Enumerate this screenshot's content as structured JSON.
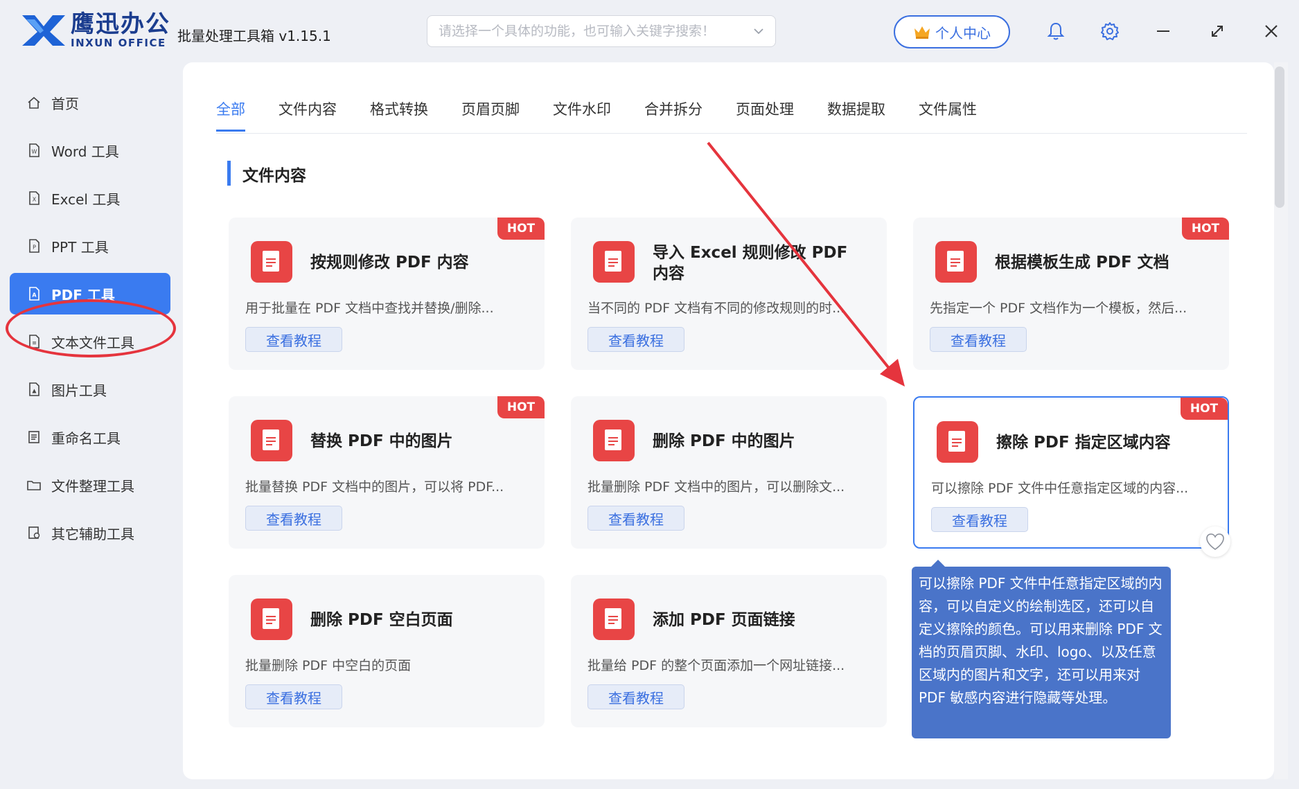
{
  "app": {
    "brand_cn": "鹰迅办公",
    "brand_en": "INXUN OFFICE",
    "title": "批量处理工具箱 v1.15.1"
  },
  "search": {
    "placeholder": "请选择一个具体的功能，也可输入关键字搜索！"
  },
  "header": {
    "user_center": "个人中心"
  },
  "sidebar": {
    "items": [
      {
        "label": "首页",
        "icon": "home-icon"
      },
      {
        "label": "Word 工具",
        "icon": "word-file-icon"
      },
      {
        "label": "Excel 工具",
        "icon": "excel-file-icon"
      },
      {
        "label": "PPT 工具",
        "icon": "ppt-file-icon"
      },
      {
        "label": "PDF 工具",
        "icon": "pdf-file-icon",
        "active": true
      },
      {
        "label": "文本文件工具",
        "icon": "text-file-icon"
      },
      {
        "label": "图片工具",
        "icon": "image-file-icon"
      },
      {
        "label": "重命名工具",
        "icon": "rename-icon"
      },
      {
        "label": "文件整理工具",
        "icon": "folder-icon"
      },
      {
        "label": "其它辅助工具",
        "icon": "tools-icon"
      }
    ]
  },
  "tabs": [
    {
      "label": "全部",
      "active": true
    },
    {
      "label": "文件内容"
    },
    {
      "label": "格式转换"
    },
    {
      "label": "页眉页脚"
    },
    {
      "label": "文件水印"
    },
    {
      "label": "合并拆分"
    },
    {
      "label": "页面处理"
    },
    {
      "label": "数据提取"
    },
    {
      "label": "文件属性"
    }
  ],
  "section": {
    "title": "文件内容"
  },
  "cards": [
    {
      "title": "按规则修改 PDF 内容",
      "desc": "用于批量在 PDF 文档中查找并替换/删除...",
      "button": "查看教程",
      "badge": "HOT"
    },
    {
      "title": "导入 Excel 规则修改 PDF 内容",
      "desc": "当不同的 PDF 文档有不同的修改规则的时...",
      "button": "查看教程"
    },
    {
      "title": "根据模板生成 PDF 文档",
      "desc": "先指定一个 PDF 文档作为一个模板，然后...",
      "button": "查看教程",
      "badge": "HOT"
    },
    {
      "title": "替换 PDF 中的图片",
      "desc": "批量替换 PDF 文档中的图片，可以将 PDF...",
      "button": "查看教程",
      "badge": "HOT"
    },
    {
      "title": "删除 PDF 中的图片",
      "desc": "批量删除 PDF 文档中的图片，可以删除文...",
      "button": "查看教程"
    },
    {
      "title": "擦除 PDF 指定区域内容",
      "desc": "可以擦除 PDF 文件中任意指定区域的内容...",
      "button": "查看教程",
      "badge": "HOT"
    },
    {
      "title": "删除 PDF 空白页面",
      "desc": "批量删除 PDF 中空白的页面",
      "button": "查看教程"
    },
    {
      "title": "添加 PDF 页面链接",
      "desc": "批量给 PDF 的整个页面添加一个网址链接...",
      "button": "查看教程"
    }
  ],
  "tooltip": {
    "text": "可以擦除 PDF 文件中任意指定区域的内容，可以自定义的绘制选区，还可以自定义擦除的颜色。可以用来删除 PDF 文档的页眉页脚、水印、logo、以及任意区域内的图片和文字，还可以用来对 PDF 敏感内容进行隐藏等处理。"
  },
  "colors": {
    "accent": "#3a7bf0",
    "hot": "#e84545",
    "annotation": "#e5343d"
  }
}
